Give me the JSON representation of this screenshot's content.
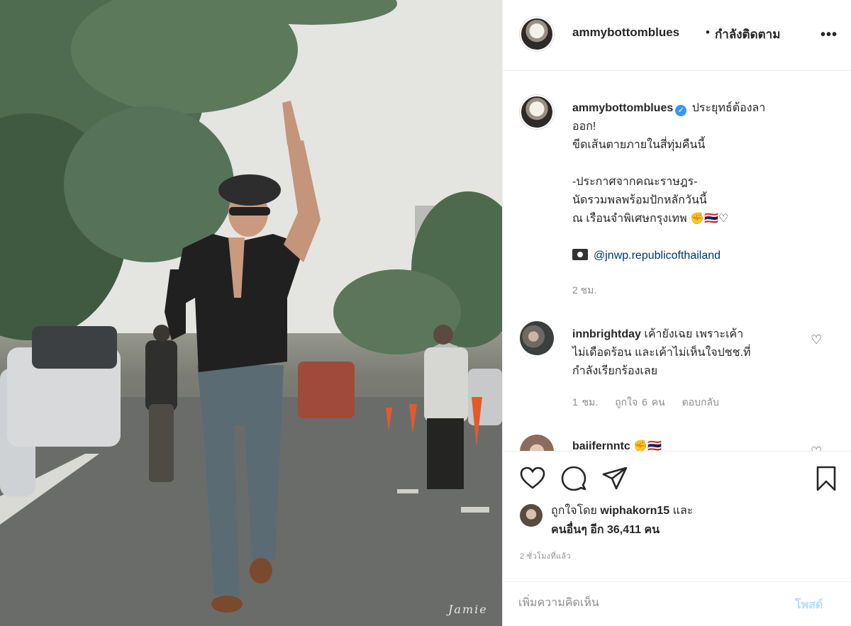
{
  "post": {
    "photo_signature": "Jamie",
    "author": "ammybottomblues",
    "header_separator": "•",
    "follow_status": "กำลังติดตาม",
    "caption": {
      "username": "ammybottomblues",
      "line1": "ประยุทธ์ต้องลา",
      "line2": "ออก!",
      "line3": "ขีดเส้นตายภายในสี่ทุ่มคืนนี้",
      "line4": "-ประกาศจากคณะราษฎร-",
      "line5": "นัดรวมพลพร้อมปักหลักวันนี้",
      "line6": "ณ เรือนจำพิเศษกรุงเทพ ✊🇹🇭♡",
      "credit": "@jnwp.republicofthailand",
      "time": "2 ชม."
    },
    "comments": [
      {
        "username": "innbrightday",
        "text1": "เค้ายังเฉย เพราะเค้า",
        "text2": "ไม่เดือดร้อน และเค้าไม่เห็นใจปชช.ที่",
        "text3": "กำลังเรียกร้องเลย",
        "time": "1 ชม.",
        "likes": "ถูกใจ 6 คน",
        "reply": "ตอบกลับ"
      },
      {
        "username": "baiifernntc ✊🇹🇭"
      }
    ],
    "likes": {
      "prefix": "ถูกใจโดย",
      "liker": "wiphakorn15",
      "and": "และ",
      "others": "คนอื่นๆ อีก 36,411 คน"
    },
    "timestamp": "2 ชั่วโมงที่แล้ว",
    "add_comment_placeholder": "เพิ่มความคิดเห็น",
    "post_label": "โพสต์"
  },
  "colors": {
    "link": "#00376b",
    "verified": "#3897f0",
    "post_button_disabled": "#b2dffc",
    "muted": "#8e8e8e"
  },
  "icons": [
    "more-icon",
    "verified-icon",
    "camera-icon",
    "heart-icon",
    "comment-icon",
    "share-icon",
    "bookmark-icon"
  ]
}
